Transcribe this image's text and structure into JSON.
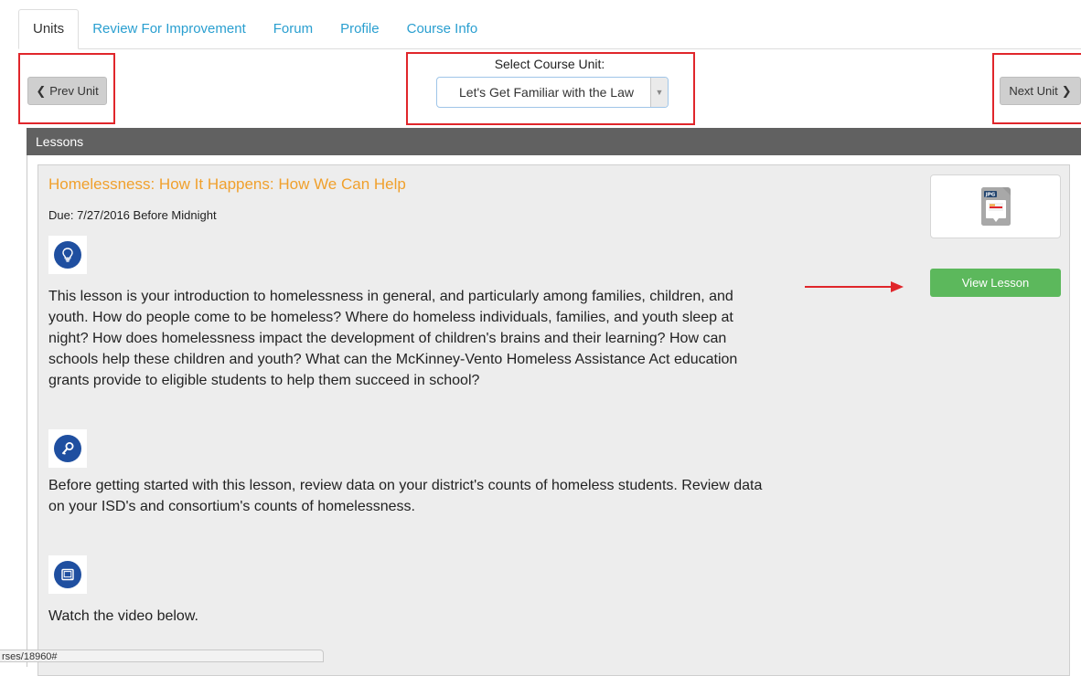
{
  "tabs": [
    {
      "label": "Units",
      "active": true
    },
    {
      "label": "Review For Improvement",
      "active": false
    },
    {
      "label": "Forum",
      "active": false
    },
    {
      "label": "Profile",
      "active": false
    },
    {
      "label": "Course Info",
      "active": false
    }
  ],
  "nav": {
    "prev_label": "Prev Unit",
    "next_label": "Next Unit",
    "select_label": "Select Course Unit:",
    "select_value": "Let's Get Familiar with the Law"
  },
  "lessons": {
    "header": "Lessons",
    "item": {
      "title": "Homelessness: How It Happens: How We Can Help",
      "due": "Due: 7/27/2016 Before Midnight",
      "view_button": "View Lesson",
      "thumbnail_label": "JPG",
      "sections": [
        {
          "icon": "lightbulb-icon",
          "text": "This lesson is your introduction to homelessness in general, and particularly among families, children, and youth. How do people come to be homeless?  Where do homeless individuals, families, and youth sleep at night?  How does homelessness impact the development of children's brains and their learning?  How can schools help these children and youth?  What can the McKinney-Vento Homeless Assistance Act education grants provide to eligible students to help them succeed in school?"
        },
        {
          "icon": "key-icon",
          "text": "Before getting started with this lesson, review data on your district's counts of homeless students. Review data on your ISD's and consortium's counts of homelessness."
        },
        {
          "icon": "video-icon",
          "text": "Watch the video below."
        }
      ]
    }
  },
  "status_bar": {
    "url": "rses/18960#"
  },
  "colors": {
    "accent_orange": "#f0a02c",
    "link_blue": "#2a9fd0",
    "highlight_red": "#e0262b",
    "button_green": "#5cb85c"
  }
}
